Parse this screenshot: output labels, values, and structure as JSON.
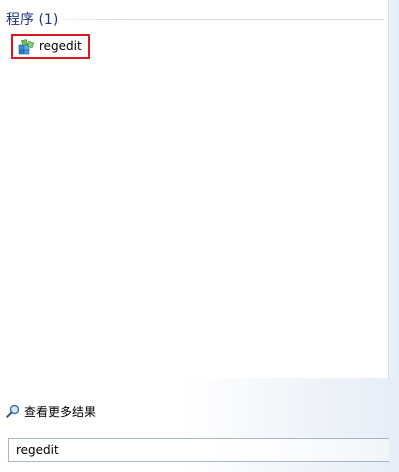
{
  "results": {
    "group_title": "程序 (1)",
    "items": [
      {
        "label": "regedit",
        "icon": "registry-editor-icon"
      }
    ]
  },
  "see_more": {
    "label": "查看更多结果",
    "icon": "search-icon"
  },
  "search": {
    "value": "regedit"
  },
  "colors": {
    "group_title": "#1e3287",
    "highlight_border": "#d9191f",
    "search_border": "#a9b6c7"
  }
}
